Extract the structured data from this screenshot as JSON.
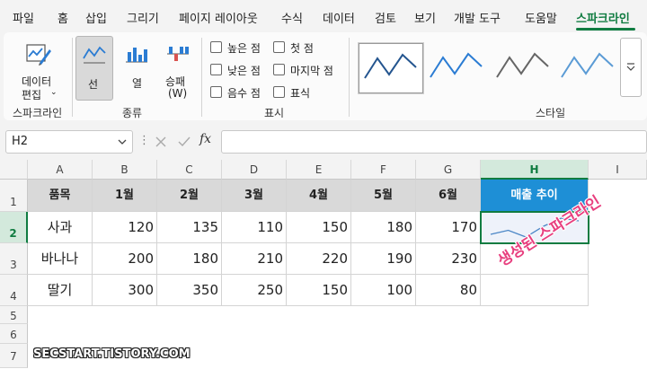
{
  "tabs": [
    "파일",
    "홈",
    "삽입",
    "그리기",
    "페이지 레이아웃",
    "수식",
    "데이터",
    "검토",
    "보기",
    "개발 도구",
    "도움말",
    "스파크라인"
  ],
  "ribbon": {
    "edit_data_label_1": "데이터",
    "edit_data_label_2": "편집",
    "type_line": "선",
    "type_column": "열",
    "type_winloss_1": "승패",
    "type_winloss_2": "(W)",
    "show_options": {
      "high_point": "높은 점",
      "low_point": "낮은 점",
      "negative_points": "음수 점",
      "first_point": "첫 점",
      "last_point": "마지막 점",
      "markers": "표식"
    },
    "group_sparkline": "스파크라인",
    "group_type": "종류",
    "group_show": "표시",
    "group_style": "스타일"
  },
  "formula_bar": {
    "name_box": "H2",
    "fx": "fx",
    "formula": ""
  },
  "columns": [
    "A",
    "B",
    "C",
    "D",
    "E",
    "F",
    "G",
    "H",
    "I"
  ],
  "rows": [
    "1",
    "2",
    "3",
    "4",
    "5",
    "6",
    "7"
  ],
  "table": {
    "headers": [
      "품목",
      "1월",
      "2월",
      "3월",
      "4월",
      "5월",
      "6월",
      "매출 추이"
    ],
    "data": [
      {
        "item": "사과",
        "values": [
          "120",
          "135",
          "110",
          "150",
          "180",
          "170"
        ]
      },
      {
        "item": "바나나",
        "values": [
          "200",
          "180",
          "210",
          "220",
          "190",
          "230"
        ]
      },
      {
        "item": "딸기",
        "values": [
          "300",
          "350",
          "250",
          "150",
          "100",
          "80"
        ]
      }
    ]
  },
  "sparkline_values": [
    120,
    135,
    110,
    150,
    180,
    170
  ],
  "annotation": "생성된 스파크라인",
  "watermark": "SECSTART.TISTORY.COM",
  "colors": {
    "accent_green": "#107c41",
    "sparkline_header_blue": "#1e8fd6",
    "sparkline_line": "#4a86c6",
    "annotation_pink": "#e8407f"
  }
}
